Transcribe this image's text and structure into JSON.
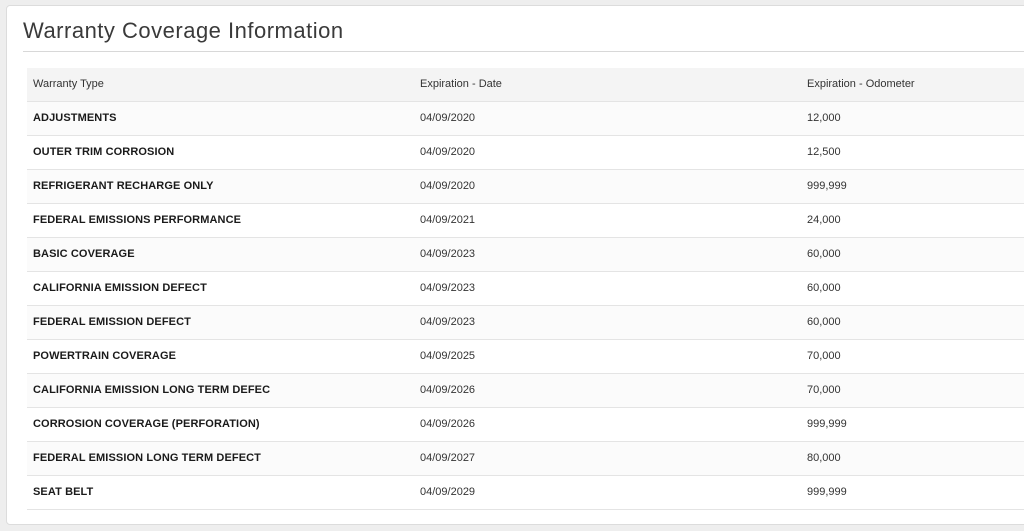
{
  "panel": {
    "title": "Warranty Coverage Information"
  },
  "table": {
    "headers": [
      "Warranty Type",
      "Expiration - Date",
      "Expiration - Odometer"
    ],
    "rows": [
      [
        "ADJUSTMENTS",
        "04/09/2020",
        "12,000"
      ],
      [
        "OUTER TRIM CORROSION",
        "04/09/2020",
        "12,500"
      ],
      [
        "REFRIGERANT RECHARGE ONLY",
        "04/09/2020",
        "999,999"
      ],
      [
        "FEDERAL EMISSIONS PERFORMANCE",
        "04/09/2021",
        "24,000"
      ],
      [
        "BASIC COVERAGE",
        "04/09/2023",
        "60,000"
      ],
      [
        "CALIFORNIA EMISSION DEFECT",
        "04/09/2023",
        "60,000"
      ],
      [
        "FEDERAL EMISSION DEFECT",
        "04/09/2023",
        "60,000"
      ],
      [
        "POWERTRAIN COVERAGE",
        "04/09/2025",
        "70,000"
      ],
      [
        "CALIFORNIA EMISSION LONG TERM DEFEC",
        "04/09/2026",
        "70,000"
      ],
      [
        "CORROSION COVERAGE (PERFORATION)",
        "04/09/2026",
        "999,999"
      ],
      [
        "FEDERAL EMISSION LONG TERM DEFECT",
        "04/09/2027",
        "80,000"
      ],
      [
        "SEAT BELT",
        "04/09/2029",
        "999,999"
      ]
    ]
  }
}
